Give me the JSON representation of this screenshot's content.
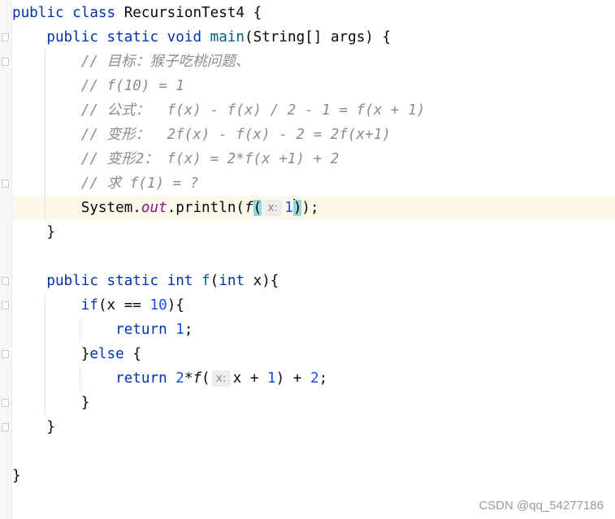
{
  "editor": {
    "current_line": 8,
    "colors": {
      "keyword": "#0033b3",
      "function": "#00627a",
      "number": "#1750eb",
      "comment": "#8c8c8c",
      "field": "#871094",
      "bracket_match": "#93d9d9",
      "current_line": "#fdf8ea"
    },
    "lines": [
      {
        "indent": 0,
        "tokens": [
          {
            "t": "public class ",
            "c": "kw"
          },
          {
            "t": "RecursionTest4 {",
            "c": ""
          }
        ]
      },
      {
        "indent": 1,
        "tokens": [
          {
            "t": "public static void ",
            "c": "kw"
          },
          {
            "t": "main",
            "c": "fn"
          },
          {
            "t": "(String[] args) {",
            "c": ""
          }
        ]
      },
      {
        "indent": 2,
        "tokens": [
          {
            "t": "// 目标：猴子吃桃问题、",
            "c": "cm"
          }
        ]
      },
      {
        "indent": 2,
        "tokens": [
          {
            "t": "// f(10) = 1",
            "c": "cm"
          }
        ]
      },
      {
        "indent": 2,
        "tokens": [
          {
            "t": "// 公式：  f(x) - f(x) / 2 - 1 = f(x + 1)",
            "c": "cm"
          }
        ]
      },
      {
        "indent": 2,
        "tokens": [
          {
            "t": "// 变形：  2f(x) - f(x) - 2 = 2f(x+1)",
            "c": "cm"
          }
        ]
      },
      {
        "indent": 2,
        "tokens": [
          {
            "t": "// 变形2： f(x) = 2*f(x +1) + 2",
            "c": "cm"
          }
        ]
      },
      {
        "indent": 2,
        "tokens": [
          {
            "t": "// 求 f(1) = ?",
            "c": "cm"
          }
        ]
      },
      {
        "indent": 2,
        "tokens": [
          {
            "t": "System.",
            "c": ""
          },
          {
            "t": "out",
            "c": "field"
          },
          {
            "t": ".println(",
            "c": ""
          },
          {
            "t": "f",
            "c": "ital"
          },
          {
            "t": "(",
            "c": "match"
          },
          {
            "t": "x:",
            "c": "hint"
          },
          {
            "t": "1",
            "c": "num"
          },
          {
            "t": "",
            "c": "caret"
          },
          {
            "t": ")",
            "c": "match"
          },
          {
            "t": ");",
            "c": ""
          }
        ]
      },
      {
        "indent": 1,
        "tokens": [
          {
            "t": "}",
            "c": ""
          }
        ]
      },
      {
        "indent": 0,
        "tokens": []
      },
      {
        "indent": 1,
        "tokens": [
          {
            "t": "public static int ",
            "c": "kw"
          },
          {
            "t": "f",
            "c": "fn"
          },
          {
            "t": "(",
            "c": ""
          },
          {
            "t": "int ",
            "c": "kw"
          },
          {
            "t": "x){",
            "c": ""
          }
        ]
      },
      {
        "indent": 2,
        "tokens": [
          {
            "t": "if",
            "c": "kw"
          },
          {
            "t": "(x == ",
            "c": ""
          },
          {
            "t": "10",
            "c": "num"
          },
          {
            "t": "){",
            "c": ""
          }
        ]
      },
      {
        "indent": 3,
        "tokens": [
          {
            "t": "return ",
            "c": "kw"
          },
          {
            "t": "1",
            "c": "num"
          },
          {
            "t": ";",
            "c": ""
          }
        ]
      },
      {
        "indent": 2,
        "tokens": [
          {
            "t": "}",
            "c": ""
          },
          {
            "t": "else ",
            "c": "kw"
          },
          {
            "t": "{",
            "c": ""
          }
        ]
      },
      {
        "indent": 3,
        "tokens": [
          {
            "t": "return ",
            "c": "kw"
          },
          {
            "t": "2",
            "c": "num"
          },
          {
            "t": "*",
            "c": ""
          },
          {
            "t": "f",
            "c": "ital"
          },
          {
            "t": "(",
            "c": ""
          },
          {
            "t": "x:",
            "c": "hint"
          },
          {
            "t": "x + ",
            "c": ""
          },
          {
            "t": "1",
            "c": "num"
          },
          {
            "t": ") + ",
            "c": ""
          },
          {
            "t": "2",
            "c": "num"
          },
          {
            "t": ";",
            "c": ""
          }
        ]
      },
      {
        "indent": 2,
        "tokens": [
          {
            "t": "}",
            "c": ""
          }
        ]
      },
      {
        "indent": 1,
        "tokens": [
          {
            "t": "}",
            "c": ""
          }
        ]
      },
      {
        "indent": 0,
        "tokens": []
      },
      {
        "indent": 0,
        "tokens": [
          {
            "t": "}",
            "c": ""
          }
        ]
      }
    ]
  },
  "watermark": "CSDN @qq_54277186"
}
